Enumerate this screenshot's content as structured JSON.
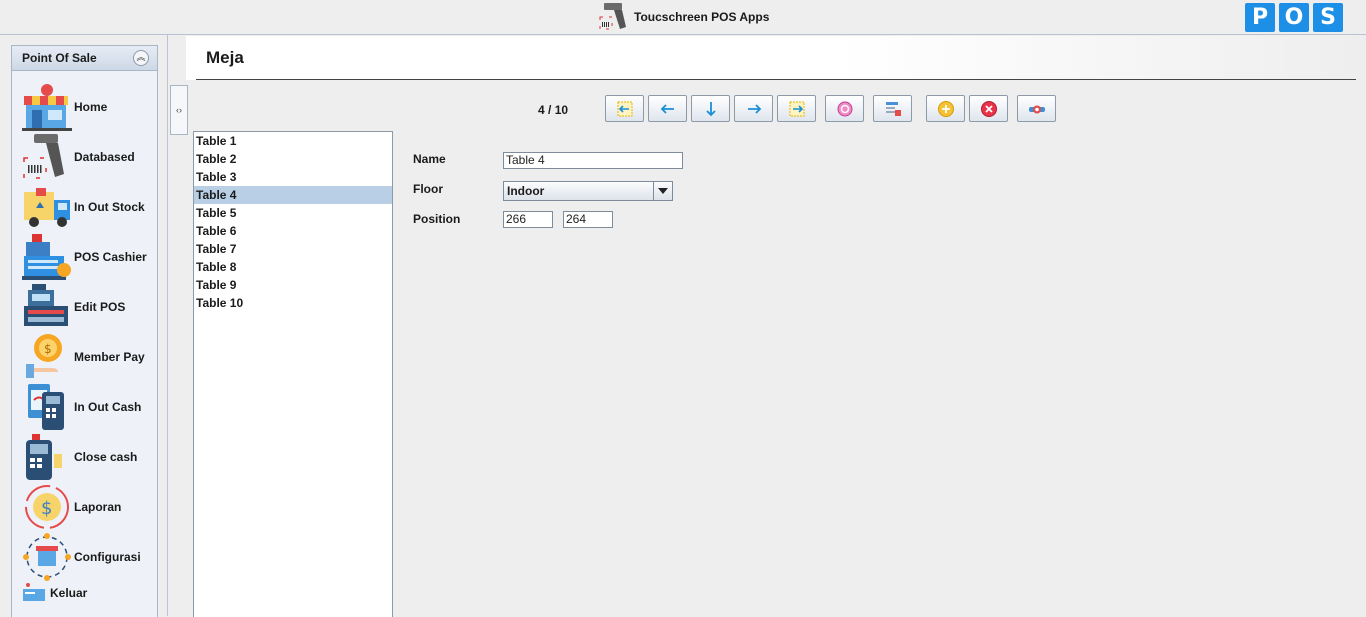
{
  "app": {
    "title": "Toucschreen POS Apps",
    "brand_letters": [
      "P",
      "O",
      "S"
    ],
    "brand_color": "#1e8fe6"
  },
  "sidebar": {
    "title": "Point Of Sale",
    "items": [
      {
        "label": "Home",
        "icon": "shop-icon"
      },
      {
        "label": "Databased",
        "icon": "barcode-scanner-icon"
      },
      {
        "label": "In Out Stock",
        "icon": "delivery-truck-icon"
      },
      {
        "label": "POS Cashier",
        "icon": "cash-register-icon"
      },
      {
        "label": "Edit POS",
        "icon": "pos-terminal-icon"
      },
      {
        "label": "Member Pay",
        "icon": "coin-hand-icon"
      },
      {
        "label": "In Out Cash",
        "icon": "card-reader-icon"
      },
      {
        "label": "Close cash",
        "icon": "edc-machine-icon"
      },
      {
        "label": "Laporan",
        "icon": "dollar-cycle-icon"
      },
      {
        "label": "Configurasi",
        "icon": "network-store-icon"
      },
      {
        "label": "Keluar",
        "icon": "exit-card-icon"
      }
    ]
  },
  "page": {
    "title": "Meja"
  },
  "navigator": {
    "current": "4",
    "separator": "/",
    "total": "10",
    "buttons": [
      {
        "name": "first-record-button",
        "icon": "first-icon"
      },
      {
        "name": "previous-record-button",
        "icon": "arrow-left-icon"
      },
      {
        "name": "reload-button",
        "icon": "arrow-down-icon"
      },
      {
        "name": "next-record-button",
        "icon": "arrow-right-icon"
      },
      {
        "name": "last-record-button",
        "icon": "last-icon"
      },
      {
        "name": "refresh-button",
        "icon": "refresh-icon"
      },
      {
        "name": "sort-button",
        "icon": "sort-icon"
      },
      {
        "name": "add-button",
        "icon": "add-icon"
      },
      {
        "name": "delete-button",
        "icon": "delete-icon"
      },
      {
        "name": "save-button",
        "icon": "save-icon"
      }
    ]
  },
  "tables": {
    "items": [
      "Table 1",
      "Table 2",
      "Table 3",
      "Table 4",
      "Table 5",
      "Table 6",
      "Table 7",
      "Table 8",
      "Table 9",
      "Table 10"
    ],
    "selected": "Table 4"
  },
  "form": {
    "name_label": "Name",
    "name_value": "Table 4",
    "floor_label": "Floor",
    "floor_value": "Indoor",
    "position_label": "Position",
    "position_x": "266",
    "position_y": "264"
  }
}
